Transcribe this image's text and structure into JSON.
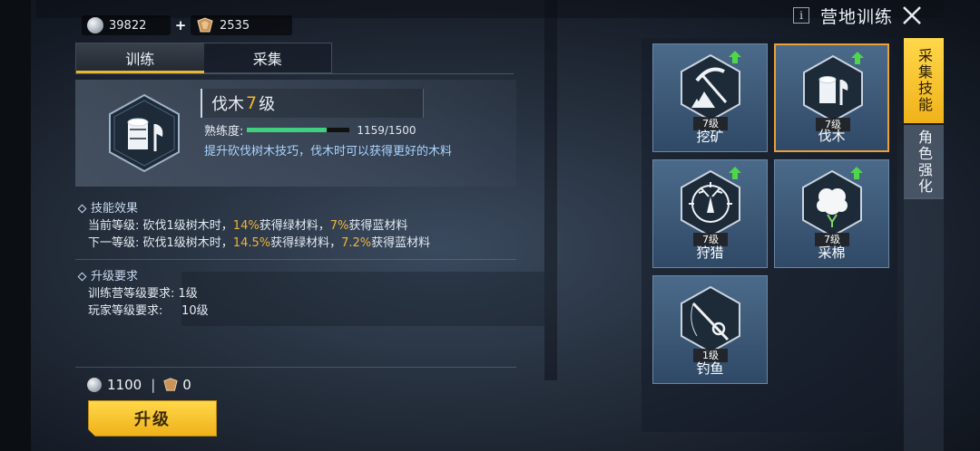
{
  "header": {
    "title": "营地训练",
    "info_label": "i"
  },
  "currency": {
    "silver": "39822",
    "plus": "+",
    "gems": "2535"
  },
  "tabs": [
    {
      "label": "训练",
      "active": true
    },
    {
      "label": "采集",
      "active": false
    }
  ],
  "skill": {
    "name": "伐木",
    "level": "7",
    "level_suffix": "级",
    "icon": "log-axe-icon",
    "proficiency_label": "熟练度:",
    "proficiency_value": "1159/1500",
    "proficiency_fraction": 0.773,
    "description": "提升砍伐树木技巧，伐木时可以获得更好的木料"
  },
  "effects": {
    "heading": "技能效果",
    "current": {
      "prefix": "当前等级: 砍伐1级树木时，",
      "green_pct": "14%",
      "mid": "获得绿材料，",
      "blue_pct": "7%",
      "suffix": "获得蓝材料"
    },
    "next": {
      "prefix": "下一等级: 砍伐1级树木时，",
      "green_pct": "14.5%",
      "mid": "获得绿材料，",
      "blue_pct": "7.2%",
      "suffix": "获得蓝材料"
    }
  },
  "requirements": {
    "heading": "升级要求",
    "camp": "训练营等级要求: 1级",
    "player": "玩家等级要求:     10级"
  },
  "cost": {
    "silver": "1100",
    "separator": "|",
    "gems": "0"
  },
  "upgrade_button": "升级",
  "skills_grid": [
    {
      "name": "挖矿",
      "level": "7级",
      "icon": "pickaxe-ore-icon",
      "upgradable": true,
      "selected": false
    },
    {
      "name": "伐木",
      "level": "7级",
      "icon": "log-axe-icon",
      "upgradable": true,
      "selected": true
    },
    {
      "name": "狩猎",
      "level": "7级",
      "icon": "deer-crosshair-icon",
      "upgradable": true,
      "selected": false
    },
    {
      "name": "采棉",
      "level": "7级",
      "icon": "cotton-icon",
      "upgradable": true,
      "selected": false
    },
    {
      "name": "钓鱼",
      "level": "1级",
      "icon": "fishing-rod-icon",
      "upgradable": false,
      "selected": false
    }
  ],
  "side_tabs": [
    {
      "label": "采集技能",
      "active": true
    },
    {
      "label": "角色强化",
      "active": false
    }
  ],
  "colors": {
    "accent_gold": "#f2b630",
    "proficiency_green": "#3fd07f",
    "description_blue": "#a9d3ff",
    "selected_border": "#e9a13a"
  }
}
